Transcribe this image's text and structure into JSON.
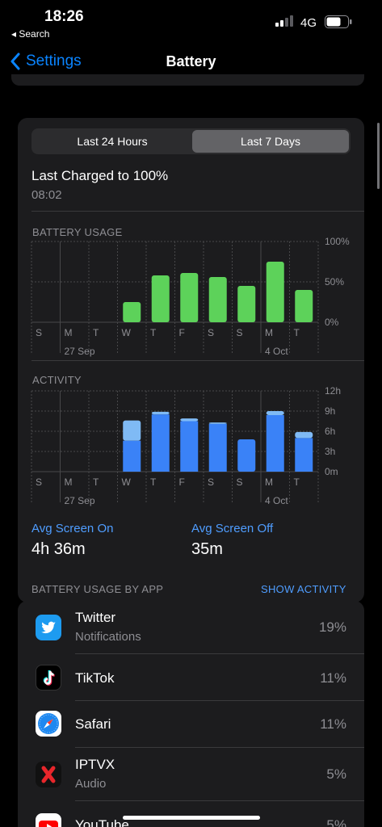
{
  "status": {
    "time": "18:26",
    "back_app": "◂ Search",
    "network": "4G"
  },
  "nav": {
    "back_label": "Settings",
    "title": "Battery"
  },
  "segmented": {
    "options": [
      "Last 24 Hours",
      "Last 7 Days"
    ],
    "selected": "Last 7 Days"
  },
  "last_charged": {
    "title": "Last Charged to 100%",
    "time": "08:02"
  },
  "chart_data": [
    {
      "type": "bar",
      "title": "BATTERY USAGE",
      "categories": [
        "S",
        "M",
        "T",
        "W",
        "T",
        "F",
        "S",
        "S",
        "M",
        "T"
      ],
      "date_labels": [
        "27 Sep",
        "4 Oct"
      ],
      "y_ticks": [
        "100%",
        "50%",
        "0%"
      ],
      "ylim": [
        0,
        100
      ],
      "color": "#5dd25a",
      "series": [
        {
          "values": [
            0,
            0,
            0,
            25,
            58,
            61,
            56,
            45,
            75,
            40
          ]
        }
      ]
    },
    {
      "type": "bar",
      "title": "ACTIVITY",
      "categories": [
        "S",
        "M",
        "T",
        "W",
        "T",
        "F",
        "S",
        "S",
        "M",
        "T"
      ],
      "date_labels": [
        "27 Sep",
        "4 Oct"
      ],
      "y_ticks": [
        "12h",
        "9h",
        "6h",
        "3h",
        "0m"
      ],
      "ylim": [
        0,
        12
      ],
      "stacked": true,
      "colors": {
        "screen_on": "#3a82f7",
        "screen_off": "#7fbaf5"
      },
      "series": [
        {
          "key": "screen_on",
          "values": [
            0,
            0,
            0,
            4.6,
            8.5,
            7.5,
            7.1,
            4.8,
            8.4,
            5.0
          ]
        },
        {
          "key": "screen_off",
          "values": [
            0,
            0,
            0,
            3.0,
            0.4,
            0.4,
            0.2,
            0,
            0.6,
            0.9
          ]
        }
      ]
    }
  ],
  "stats": {
    "screen_on_label": "Avg Screen On",
    "screen_on_value": "4h 36m",
    "screen_off_label": "Avg Screen Off",
    "screen_off_value": "35m"
  },
  "apps_section": {
    "label": "BATTERY USAGE BY APP",
    "action": "SHOW ACTIVITY"
  },
  "apps": [
    {
      "name": "Twitter",
      "sub": "Notifications",
      "pct": "19%",
      "icon": "twitter-icon"
    },
    {
      "name": "TikTok",
      "sub": "",
      "pct": "11%",
      "icon": "tiktok-icon"
    },
    {
      "name": "Safari",
      "sub": "",
      "pct": "11%",
      "icon": "safari-icon"
    },
    {
      "name": "IPTVX",
      "sub": "Audio",
      "pct": "5%",
      "icon": "iptvx-icon"
    },
    {
      "name": "YouTube",
      "sub": "",
      "pct": "5%",
      "icon": "youtube-icon"
    }
  ]
}
